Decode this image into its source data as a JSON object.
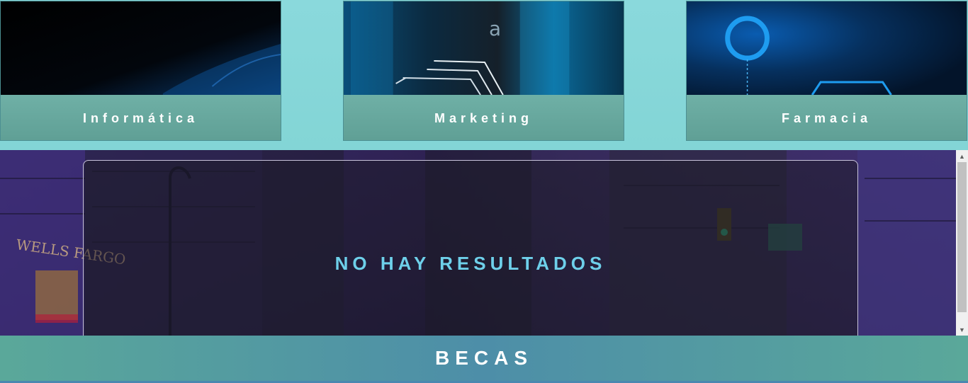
{
  "categories": [
    {
      "label": "Informática",
      "image_icon": "dark-tech-image"
    },
    {
      "label": "Marketing",
      "image_icon": "circuit-tech-image"
    },
    {
      "label": "Farmacia",
      "image_icon": "blue-ring-tech-image"
    }
  ],
  "card_image_glyph": "a",
  "results": {
    "message": "NO HAY RESULTADOS",
    "background_icon": "city-street-image",
    "sign_text": "WELLS FARGO"
  },
  "footer": {
    "label": "BECAS"
  },
  "colors": {
    "accent": "#6ed0ea",
    "card_label_bg": "#64a69c",
    "page_bg": "#82d6d6"
  }
}
